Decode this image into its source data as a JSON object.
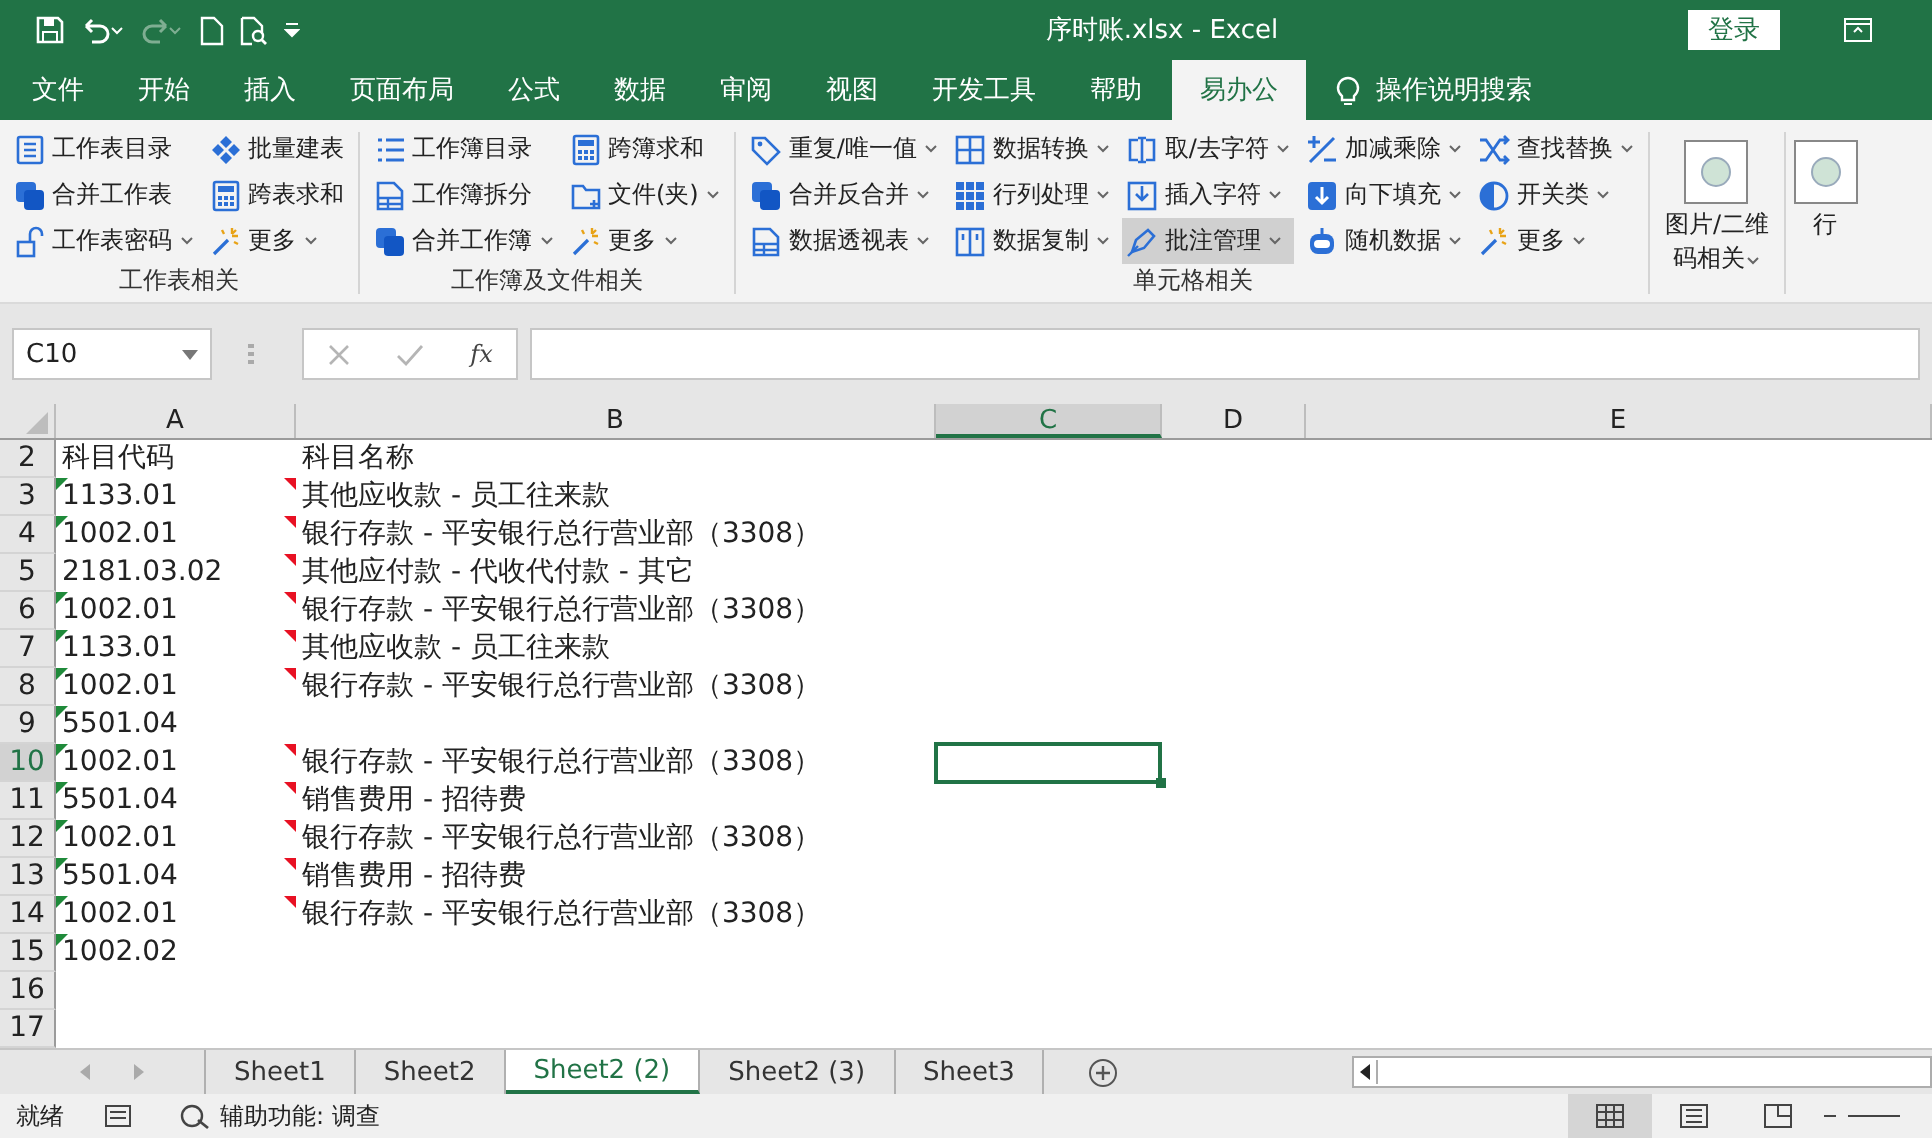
{
  "title_bar": {
    "title": "序时账.xlsx  -  Excel",
    "signin": "登录"
  },
  "tabs": [
    {
      "label": "文件",
      "selected": false
    },
    {
      "label": "开始",
      "selected": false
    },
    {
      "label": "插入",
      "selected": false
    },
    {
      "label": "页面布局",
      "selected": false
    },
    {
      "label": "公式",
      "selected": false
    },
    {
      "label": "数据",
      "selected": false
    },
    {
      "label": "审阅",
      "selected": false
    },
    {
      "label": "视图",
      "selected": false
    },
    {
      "label": "开发工具",
      "selected": false
    },
    {
      "label": "帮助",
      "selected": false
    },
    {
      "label": "易办公",
      "selected": true
    }
  ],
  "tell_me": "操作说明搜索",
  "ribbon_groups": [
    {
      "kind": "small",
      "label": "工作表相关",
      "columns": [
        [
          {
            "label": "工作表目录",
            "dropdown": false,
            "hovered": false
          },
          {
            "label": "合并工作表",
            "dropdown": false,
            "hovered": false
          },
          {
            "label": "工作表密码",
            "dropdown": true,
            "hovered": false
          }
        ],
        [
          {
            "label": "批量建表",
            "dropdown": false,
            "hovered": false
          },
          {
            "label": "跨表求和",
            "dropdown": false,
            "hovered": false
          },
          {
            "label": "更多",
            "dropdown": true,
            "hovered": false
          }
        ]
      ]
    },
    {
      "kind": "small",
      "label": "工作簿及文件相关",
      "columns": [
        [
          {
            "label": "工作簿目录",
            "dropdown": false,
            "hovered": false
          },
          {
            "label": "工作簿拆分",
            "dropdown": false,
            "hovered": false
          },
          {
            "label": "合并工作簿",
            "dropdown": true,
            "hovered": false
          }
        ],
        [
          {
            "label": "跨簿求和",
            "dropdown": false,
            "hovered": false
          },
          {
            "label": "文件(夹)",
            "dropdown": true,
            "hovered": false
          },
          {
            "label": "更多",
            "dropdown": true,
            "hovered": false
          }
        ]
      ]
    },
    {
      "kind": "small",
      "label": "单元格相关",
      "columns": [
        [
          {
            "label": "重复/唯一值",
            "dropdown": true,
            "hovered": false
          },
          {
            "label": "合并反合并",
            "dropdown": true,
            "hovered": false
          },
          {
            "label": "数据透视表",
            "dropdown": true,
            "hovered": false
          }
        ],
        [
          {
            "label": "数据转换",
            "dropdown": true,
            "hovered": false
          },
          {
            "label": "行列处理",
            "dropdown": true,
            "hovered": false
          },
          {
            "label": "数据复制",
            "dropdown": true,
            "hovered": false
          }
        ],
        [
          {
            "label": "取/去字符",
            "dropdown": true,
            "hovered": false
          },
          {
            "label": "插入字符",
            "dropdown": true,
            "hovered": false
          },
          {
            "label": "批注管理",
            "dropdown": true,
            "hovered": true
          }
        ],
        [
          {
            "label": "加减乘除",
            "dropdown": true,
            "hovered": false
          },
          {
            "label": "向下填充",
            "dropdown": true,
            "hovered": false
          },
          {
            "label": "随机数据",
            "dropdown": true,
            "hovered": false
          }
        ],
        [
          {
            "label": "查找替换",
            "dropdown": true,
            "hovered": false
          },
          {
            "label": "开关类",
            "dropdown": true,
            "hovered": false
          },
          {
            "label": "更多",
            "dropdown": true,
            "hovered": false
          }
        ]
      ]
    },
    {
      "kind": "large",
      "lines": [
        "图片/二维",
        "码相关"
      ],
      "dropdown": true
    },
    {
      "kind": "large",
      "lines": [
        "行"
      ],
      "dropdown": false
    }
  ],
  "formula_bar": {
    "name_box": "C10",
    "fx": "fx"
  },
  "columns": [
    {
      "label": "A",
      "selected": false
    },
    {
      "label": "B",
      "selected": false
    },
    {
      "label": "C",
      "selected": true
    },
    {
      "label": "D",
      "selected": false
    },
    {
      "label": "E",
      "selected": false
    }
  ],
  "rows": [
    {
      "n": "2",
      "a": "科目代码",
      "b": "科目名称",
      "text_number": false,
      "comment": false,
      "selected": false
    },
    {
      "n": "3",
      "a": "1133.01",
      "b": "其他应收款 - 员工往来款",
      "text_number": true,
      "comment": true,
      "selected": false
    },
    {
      "n": "4",
      "a": "1002.01",
      "b": "银行存款 - 平安银行总行营业部（3308）",
      "text_number": true,
      "comment": true,
      "selected": false
    },
    {
      "n": "5",
      "a": "2181.03.02",
      "b": "其他应付款 - 代收代付款 - 其它",
      "text_number": false,
      "comment": true,
      "selected": false
    },
    {
      "n": "6",
      "a": "1002.01",
      "b": "银行存款 - 平安银行总行营业部（3308）",
      "text_number": true,
      "comment": true,
      "selected": false
    },
    {
      "n": "7",
      "a": "1133.01",
      "b": "其他应收款 - 员工往来款",
      "text_number": true,
      "comment": true,
      "selected": false
    },
    {
      "n": "8",
      "a": "1002.01",
      "b": "银行存款 - 平安银行总行营业部（3308）",
      "text_number": true,
      "comment": true,
      "selected": false
    },
    {
      "n": "9",
      "a": "5501.04",
      "text_number": true,
      "comment": false,
      "selected": false
    },
    {
      "n": "10",
      "a": "1002.01",
      "b": "银行存款 - 平安银行总行营业部（3308）",
      "text_number": true,
      "comment": true,
      "selected": true
    },
    {
      "n": "11",
      "a": "5501.04",
      "b": "销售费用 - 招待费",
      "text_number": true,
      "comment": true,
      "selected": false
    },
    {
      "n": "12",
      "a": "1002.01",
      "b": "银行存款 - 平安银行总行营业部（3308）",
      "text_number": true,
      "comment": true,
      "selected": false
    },
    {
      "n": "13",
      "a": "5501.04",
      "b": "销售费用 - 招待费",
      "text_number": true,
      "comment": true,
      "selected": false
    },
    {
      "n": "14",
      "a": "1002.01",
      "b": "银行存款 - 平安银行总行营业部（3308）",
      "text_number": true,
      "comment": true,
      "selected": false
    },
    {
      "n": "15",
      "a": "1002.02",
      "text_number": true,
      "comment": false,
      "selected": false
    },
    {
      "n": "16",
      "text_number": false,
      "comment": false,
      "selected": false
    },
    {
      "n": "17",
      "text_number": false,
      "comment": false,
      "selected": false
    }
  ],
  "sheets": [
    {
      "label": "Sheet1",
      "selected": false
    },
    {
      "label": "Sheet2",
      "selected": false
    },
    {
      "label": "Sheet2 (2)",
      "selected": true
    },
    {
      "label": "Sheet2 (3)",
      "selected": false
    },
    {
      "label": "Sheet3",
      "selected": false
    }
  ],
  "status_bar": {
    "ready": "就绪",
    "accessibility": "辅助功能: 调查",
    "views": [
      {
        "selected": true
      },
      {
        "selected": false
      },
      {
        "selected": false
      }
    ]
  }
}
